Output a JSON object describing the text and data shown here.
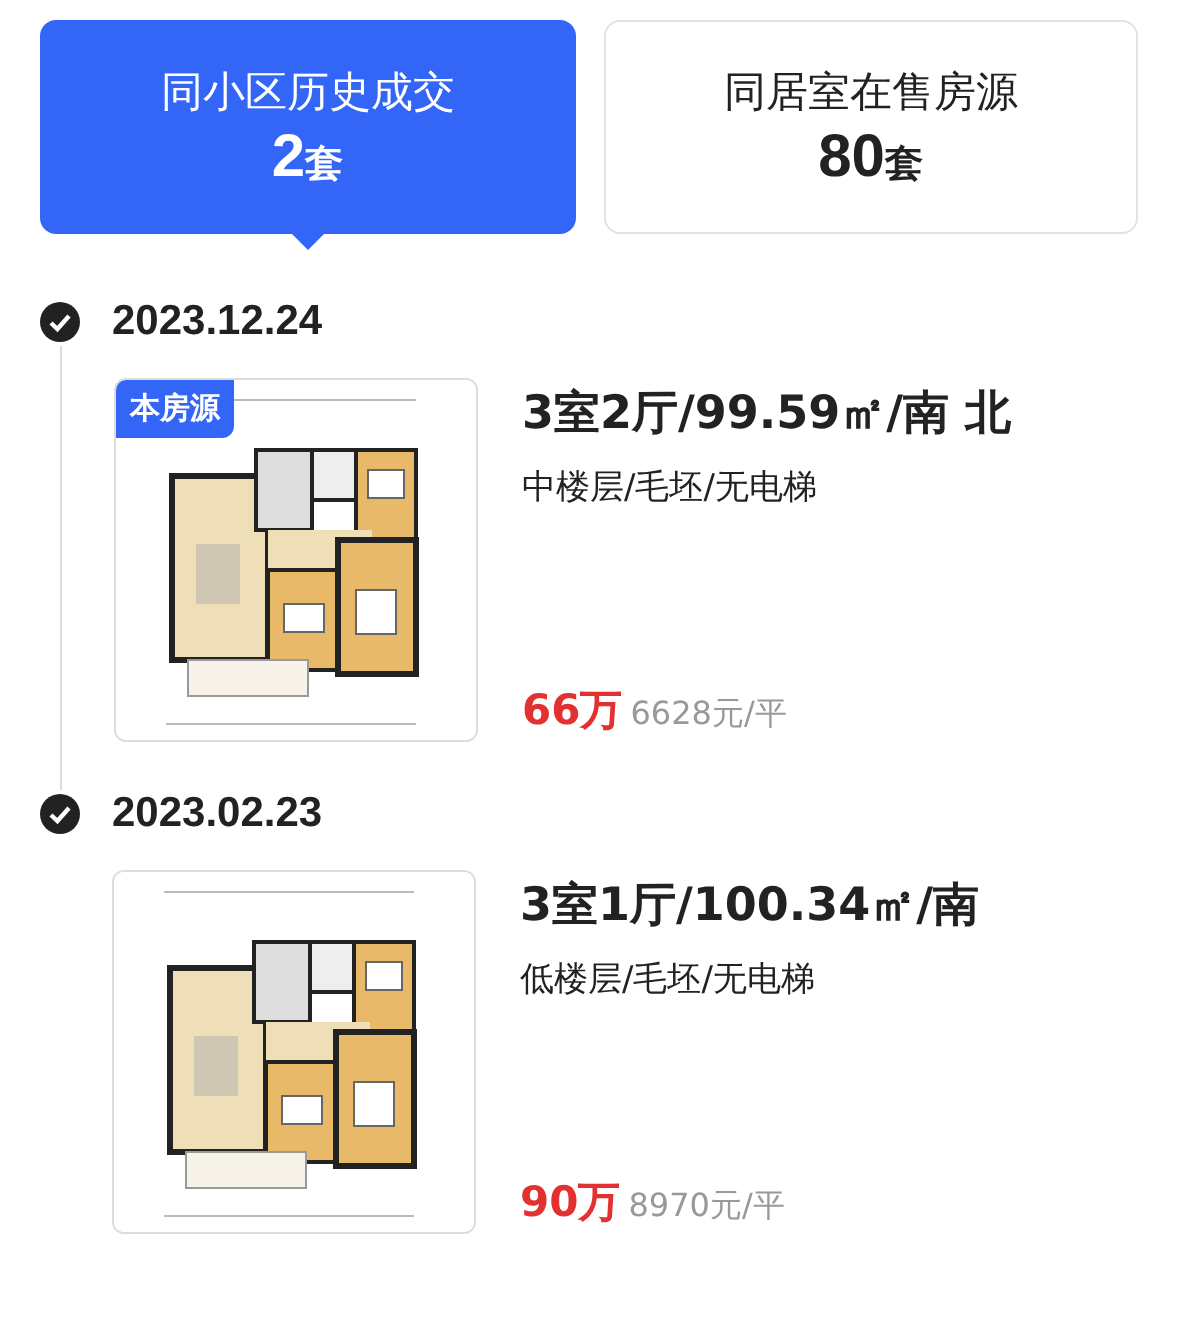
{
  "tabs": [
    {
      "label": "同小区历史成交",
      "count": "2",
      "unit": "套",
      "selected": true
    },
    {
      "label": "同居室在售房源",
      "count": "80",
      "unit": "套",
      "selected": false
    }
  ],
  "records": [
    {
      "date": "2023.12.24",
      "badge": "本房源",
      "layout": "3室2厅/99.59㎡/南 北",
      "details": "中楼层/毛坯/无电梯",
      "price": "66万",
      "unit_price": "6628元/平"
    },
    {
      "date": "2023.02.23",
      "layout": "3室1厅/100.34㎡/南",
      "details": "低楼层/毛坯/无电梯",
      "price": "90万",
      "unit_price": "8970元/平"
    }
  ]
}
